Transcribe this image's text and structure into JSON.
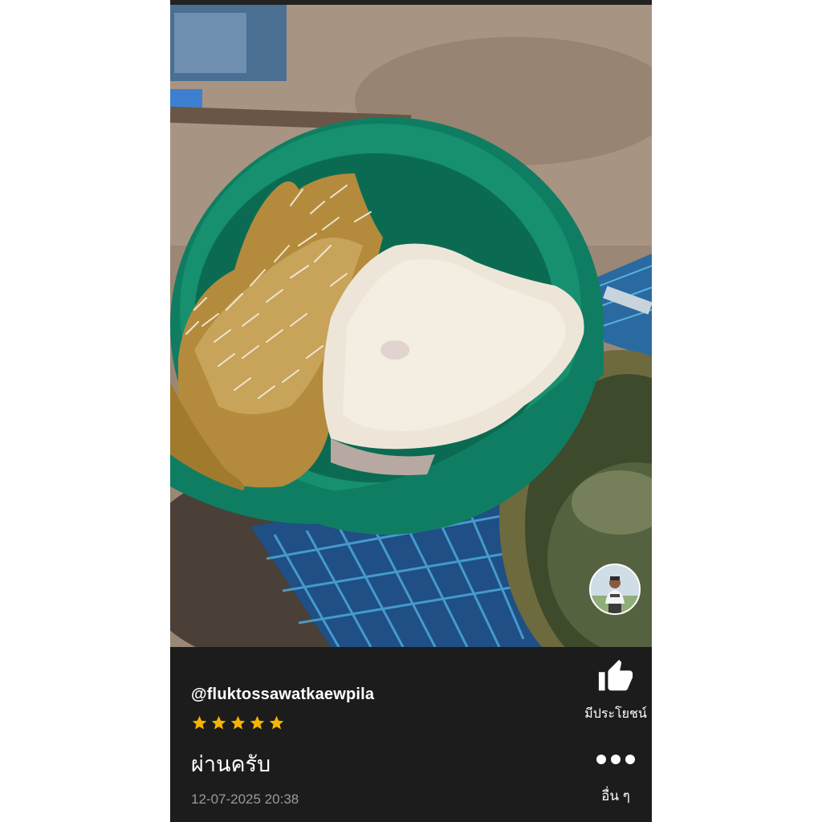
{
  "review": {
    "username": "@fluktossawatkaewpila",
    "rating": 5,
    "rating_color": "#f5b400",
    "comment": "ผ่านครับ",
    "timestamp": "12-07-2025 20:38"
  },
  "actions": {
    "helpful_label": "มีประโยชน์",
    "helpful_icon": "thumbs-up-icon",
    "more_label": "อื่น ๆ",
    "more_icon": "more-dots-icon"
  },
  "photo": {
    "description_icon": "review-photo"
  }
}
